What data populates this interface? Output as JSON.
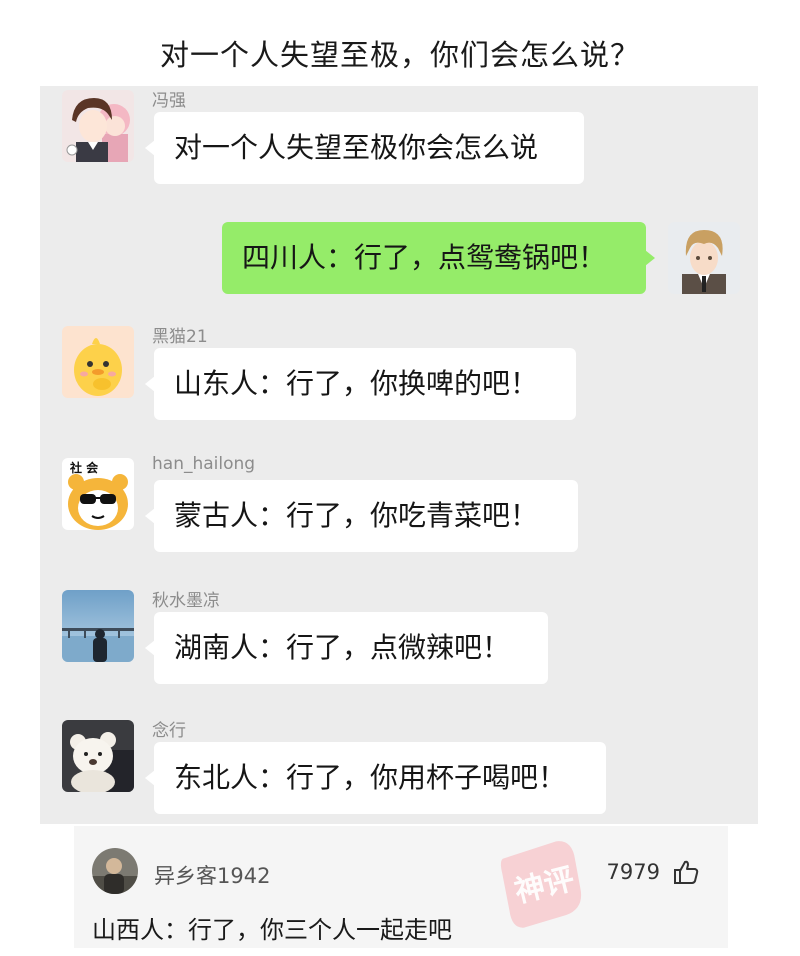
{
  "title": "对一个人失望至极，你们会怎么说？",
  "messages": [
    {
      "sender": "冯强",
      "text": "对一个人失望至极你会怎么说",
      "avatar_icon": "anime-couple-avatar-icon"
    },
    {
      "sender": "",
      "text": "四川人：行了，点鸳鸯锅吧！",
      "avatar_icon": "anime-boy-avatar-icon",
      "self": true
    },
    {
      "sender": "黑猫21",
      "text": "山东人：行了，你换啤的吧！",
      "avatar_icon": "yellow-chick-avatar-icon"
    },
    {
      "sender": "han_hailong",
      "text": "蒙古人：行了，你吃青菜吧！",
      "avatar_icon": "bear-sunglasses-avatar-icon",
      "avatar_caption": "社  会"
    },
    {
      "sender": "秋水墨凉",
      "text": "湖南人：行了，点微辣吧！",
      "avatar_icon": "seaside-pier-avatar-icon"
    },
    {
      "sender": "念行",
      "text": "东北人：行了，你用杯子喝吧！",
      "avatar_icon": "plush-bear-avatar-icon"
    }
  ],
  "comment": {
    "username": "异乡客1942",
    "likes": "7979",
    "text": "山西人：行了，你三个人一起走吧",
    "avatar_icon": "man-photo-avatar-icon",
    "like_icon": "thumbs-up-icon"
  },
  "watermark": {
    "text": "神评",
    "icon": "shenping-stamp-icon"
  },
  "colors": {
    "chat_background": "#ececec",
    "bubble_other": "#ffffff",
    "bubble_self": "#95ec69",
    "sender_name": "#8c8c8c",
    "comment_background": "#f5f5f5",
    "stamp": "#f7b3b8"
  }
}
